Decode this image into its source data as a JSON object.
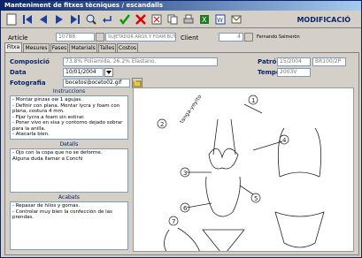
{
  "window": {
    "title": "Manteniment de fitxes tècniques / escandalls"
  },
  "toolbar": {
    "mode": "MODIFICACIÓ",
    "buttons": [
      "new",
      "first",
      "prev",
      "next",
      "last",
      "search",
      "back",
      "accept",
      "cancel",
      "delete",
      "copy",
      "print",
      "excel",
      "word",
      "email"
    ]
  },
  "header": {
    "article_label": "Article",
    "article_code": "10788",
    "article_desc": "SUJETADOR AROS Y FOAM BUTHAN",
    "client_label": "Client",
    "client_code": "4",
    "client_name": "Fernando Salmerón"
  },
  "tabs": [
    {
      "label": "Fitxa"
    },
    {
      "label": "Mesures"
    },
    {
      "label": "Fases"
    },
    {
      "label": "Materials"
    },
    {
      "label": "Talles"
    },
    {
      "label": "Costos"
    }
  ],
  "form": {
    "composicio_label": "Composició",
    "composicio_value": "73.8% Poliamida, 26.2% Elastano.",
    "data_label": "Data",
    "data_value": "10/01/2004",
    "fotografia_label": "Fotografia",
    "fotografia_value": "bocetos\\boceto02.gif",
    "patro_label": "Patró",
    "patro_value1": "15/2004",
    "patro_value2": "BR100/2P",
    "temporada_label": "Temporada",
    "temporada_value": "2003V"
  },
  "sections": {
    "instruccions_title": "Instruccions",
    "instruccions_text": "- Montar pinzas ow 1 agujas.\n- Definir con plana. Montar lycra y foam con plana, costura 4 mm.\n- Fijar lycra a foam sin estirar.\n- Poner vivo en sisa y contorno dejado sobrar para la anilla.\n- Atacarla bien.",
    "detalls_title": "Detalls",
    "detalls_text": "- Ojo con la copa que no se deforme.\nAlguna duda llamar a Conchi",
    "acabats_title": "Acabats",
    "acabats_text": "- Repasar de hilos y gomas.\n- Controlar muy bien la confección de las prendas."
  },
  "sketch": {
    "handwritten_label": "tanga-yeyito",
    "callouts": [
      "1",
      "2",
      "3",
      "4",
      "5",
      "6",
      "7"
    ]
  }
}
